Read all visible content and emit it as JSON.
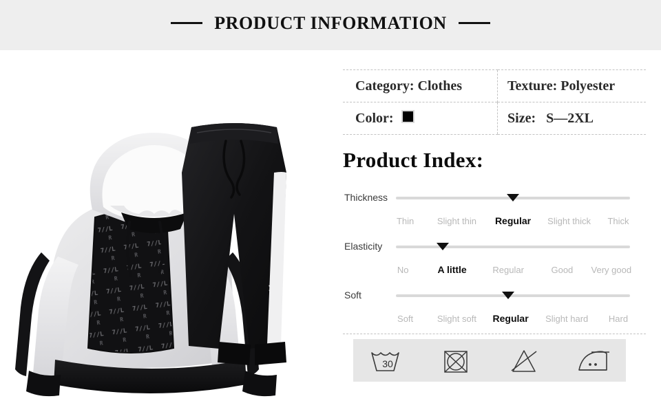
{
  "header": {
    "title": "PRODUCT INFORMATION",
    "left_rule": "horizontal-rule",
    "right_rule": "horizontal-rule"
  },
  "product_image": {
    "alt": "Black and grey hooded tracksuit set: hoodie with printed front panel and matching black joggers with white side stripes",
    "colors": {
      "hood_grey": "#e2e2e4",
      "panel_black": "#141414",
      "trim_white": "#f2f2f2",
      "background": "#ffffff"
    }
  },
  "spec_table": {
    "rows": [
      {
        "left_label": "Category:",
        "left_value": "Clothes",
        "right_label": "Texture:",
        "right_value": "Polyester"
      },
      {
        "left_label": "Color:",
        "left_value": "",
        "right_label": "Size:",
        "right_value": "S—2XL"
      }
    ],
    "color_swatch_hex": "#000000"
  },
  "product_index": {
    "heading": "Product Index:",
    "rows": [
      {
        "label": "Thickness",
        "selected": "Regular",
        "marker_percent": 50,
        "options": [
          {
            "label": "Thin",
            "percent": 4
          },
          {
            "label": "Slight thin",
            "percent": 26
          },
          {
            "label": "Regular",
            "percent": 50
          },
          {
            "label": "Slight thick",
            "percent": 74
          },
          {
            "label": "Thick",
            "percent": 95
          }
        ]
      },
      {
        "label": "Elasticity",
        "selected": "A little",
        "marker_percent": 20,
        "options": [
          {
            "label": "No",
            "percent": 3
          },
          {
            "label": "A little",
            "percent": 24
          },
          {
            "label": "Regular",
            "percent": 48
          },
          {
            "label": "Good",
            "percent": 71
          },
          {
            "label": "Very good",
            "percent": 92
          }
        ]
      },
      {
        "label": "Soft",
        "selected": "Regular",
        "marker_percent": 48,
        "options": [
          {
            "label": "Soft",
            "percent": 4
          },
          {
            "label": "Slight soft",
            "percent": 26
          },
          {
            "label": "Regular",
            "percent": 49
          },
          {
            "label": "Slight hard",
            "percent": 73
          },
          {
            "label": "Hard",
            "percent": 95
          }
        ]
      }
    ]
  },
  "care_instructions": {
    "background_hex": "#e6e6e6",
    "symbols": [
      {
        "name": "wash-30-icon",
        "meaning": "Machine wash at 30°C",
        "value": "30"
      },
      {
        "name": "do-not-tumble-dry-icon",
        "meaning": "Do not tumble dry",
        "value": ""
      },
      {
        "name": "do-not-bleach-icon",
        "meaning": "Do not bleach",
        "value": ""
      },
      {
        "name": "iron-low-icon",
        "meaning": "Iron at medium temperature (two dots)",
        "value": ""
      }
    ]
  }
}
